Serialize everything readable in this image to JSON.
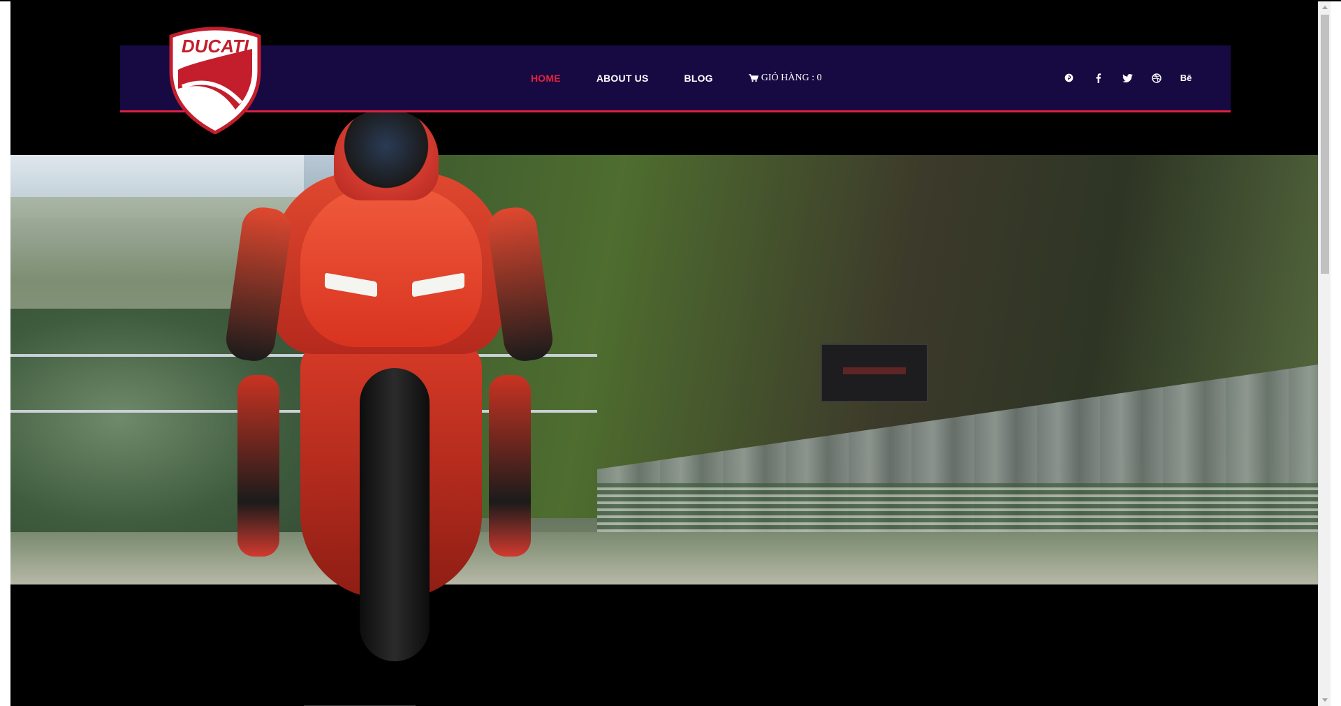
{
  "nav": {
    "items": [
      {
        "label": "HOME",
        "active": true
      },
      {
        "label": "ABOUT US",
        "active": false
      },
      {
        "label": "BLOG",
        "active": false
      }
    ],
    "cart_label": "GIỎ HÀNG : 0"
  },
  "social": {
    "icons": [
      "pinterest-icon",
      "facebook-icon",
      "twitter-icon",
      "dribbble-icon",
      "behance-icon"
    ],
    "behance_text": "Bē"
  },
  "logo": {
    "text": "DUCATI"
  },
  "colors": {
    "nav_background": "#170a42",
    "accent": "#e0213f",
    "page_background": "#000000",
    "nav_text": "#ffffff"
  },
  "scrollbar": {
    "position_fraction": 0.0
  }
}
